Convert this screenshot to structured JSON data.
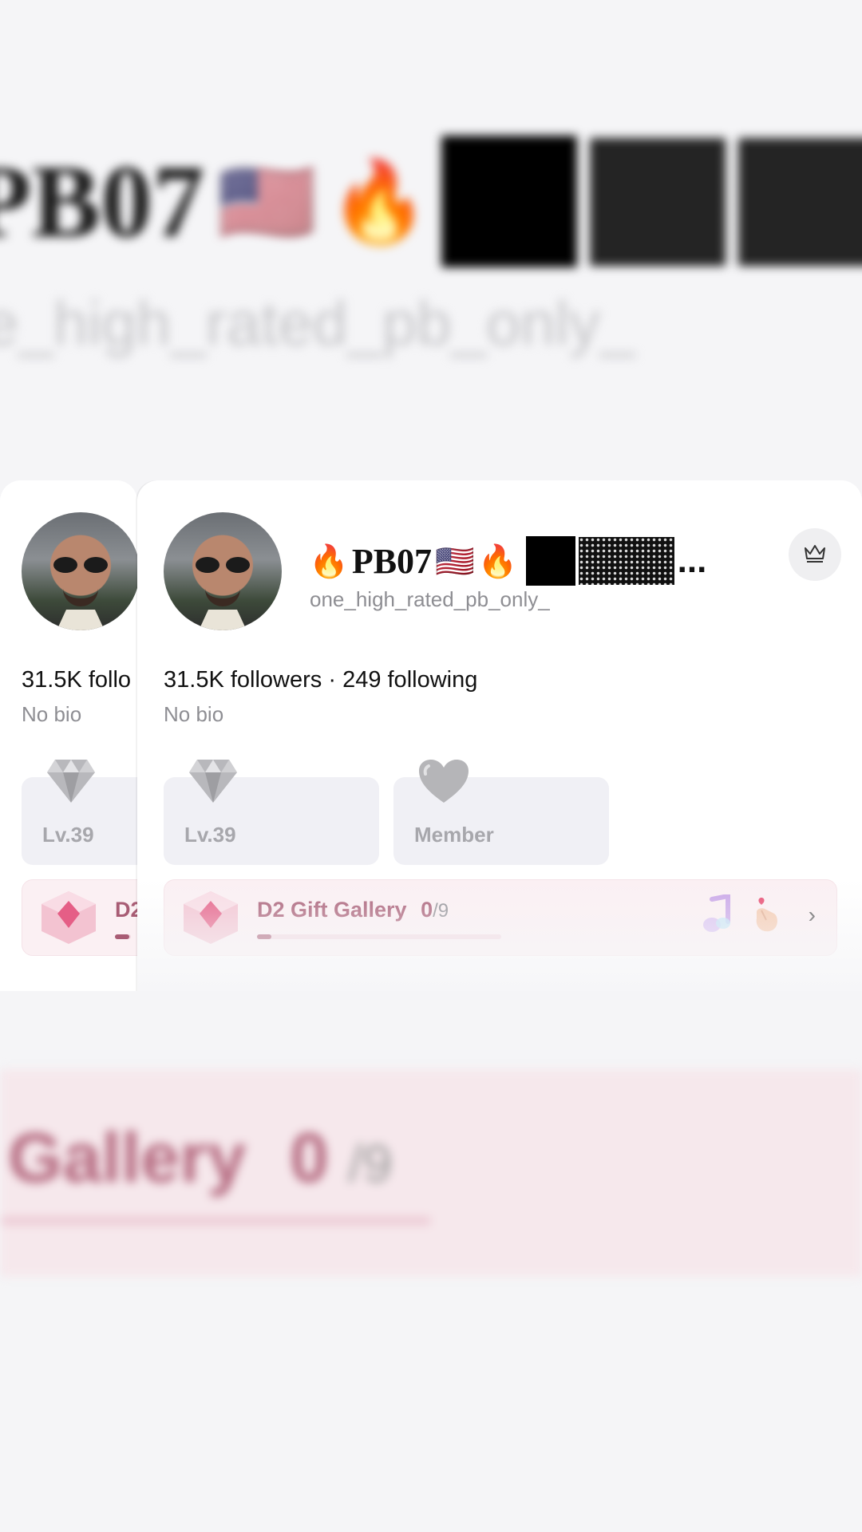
{
  "profile": {
    "display_name": "PB07",
    "name_emoji_lead": "🔥",
    "name_emoji_flag": "🇺🇸",
    "name_emoji_trail": "🔥",
    "name_ellipsis": "...",
    "handle": "one_high_rated_pb_only_",
    "followers": "31.5K followers",
    "separator": " · ",
    "following": "249 following",
    "followers_truncated": "31.5K follo",
    "bio": "No bio"
  },
  "badges": [
    {
      "label": "Lv.39",
      "icon": "diamond-icon"
    },
    {
      "label": "Member",
      "icon": "heart-icon"
    }
  ],
  "gallery": {
    "title": "D2 Gift Gallery",
    "title_truncated": "D2",
    "count": "0",
    "total": "/9",
    "progress": 0.0
  },
  "background": {
    "handle_partial": "e_high_rated_pb_only_",
    "gallery_partial": "Gallery",
    "count": "0",
    "total": "/9"
  },
  "colors": {
    "accent_pink": "#a85c74",
    "gallery_bg": "#fbf0f3",
    "badge_bg": "#f0f0f5"
  }
}
